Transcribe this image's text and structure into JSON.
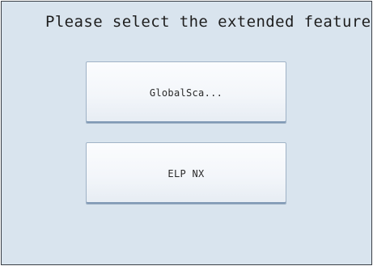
{
  "screen": {
    "title": "Please select the extended feature"
  },
  "features": [
    {
      "label": "GlobalSca..."
    },
    {
      "label": "ELP NX"
    }
  ],
  "colors": {
    "panel_background": "#d9e4ee",
    "button_face": "#f3f6fa",
    "button_border": "#9fb2c6",
    "text": "#1e1e1e"
  }
}
